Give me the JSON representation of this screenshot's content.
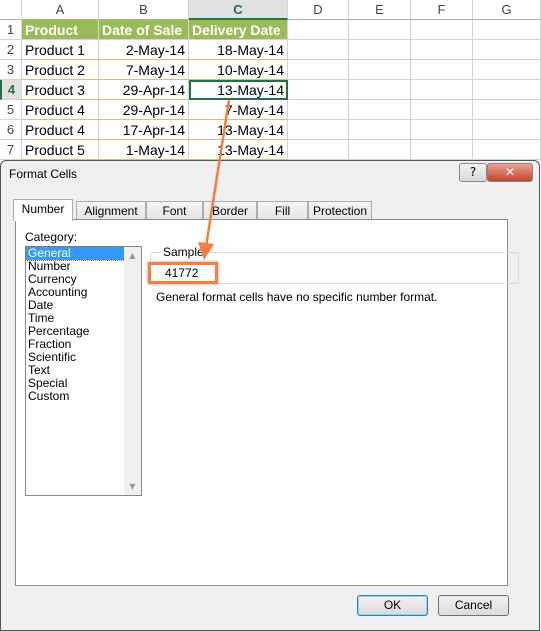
{
  "sheet": {
    "columns": [
      "A",
      "B",
      "C",
      "D",
      "E",
      "F",
      "G"
    ],
    "rows": [
      "1",
      "2",
      "3",
      "4",
      "5",
      "6",
      "7"
    ],
    "header": [
      "Product",
      "Date of Sale",
      "Delivery Date"
    ],
    "data": [
      [
        "Product 1",
        "2-May-14",
        "18-May-14"
      ],
      [
        "Product 2",
        "7-May-14",
        "10-May-14"
      ],
      [
        "Product 3",
        "29-Apr-14",
        "13-May-14"
      ],
      [
        "Product 4",
        "29-Apr-14",
        "7-May-14"
      ],
      [
        "Product 4",
        "17-Apr-14",
        "13-May-14"
      ],
      [
        "Product 5",
        "1-May-14",
        "13-May-14"
      ]
    ],
    "active_cell": "C4",
    "header_color": "#9bbb59"
  },
  "dialog": {
    "title": "Format Cells",
    "help": "?",
    "close": "✕",
    "tabs": [
      "Number",
      "Alignment",
      "Font",
      "Border",
      "Fill",
      "Protection"
    ],
    "active_tab": "Number",
    "category_label": "Category:",
    "categories": [
      "General",
      "Number",
      "Currency",
      "Accounting",
      "Date",
      "Time",
      "Percentage",
      "Fraction",
      "Scientific",
      "Text",
      "Special",
      "Custom"
    ],
    "selected_category": "General",
    "sample_label": "Sample",
    "sample_value": "41772",
    "description": "General format cells have no specific number format.",
    "ok": "OK",
    "cancel": "Cancel"
  },
  "annotation": {
    "color": "#f47f3e"
  }
}
